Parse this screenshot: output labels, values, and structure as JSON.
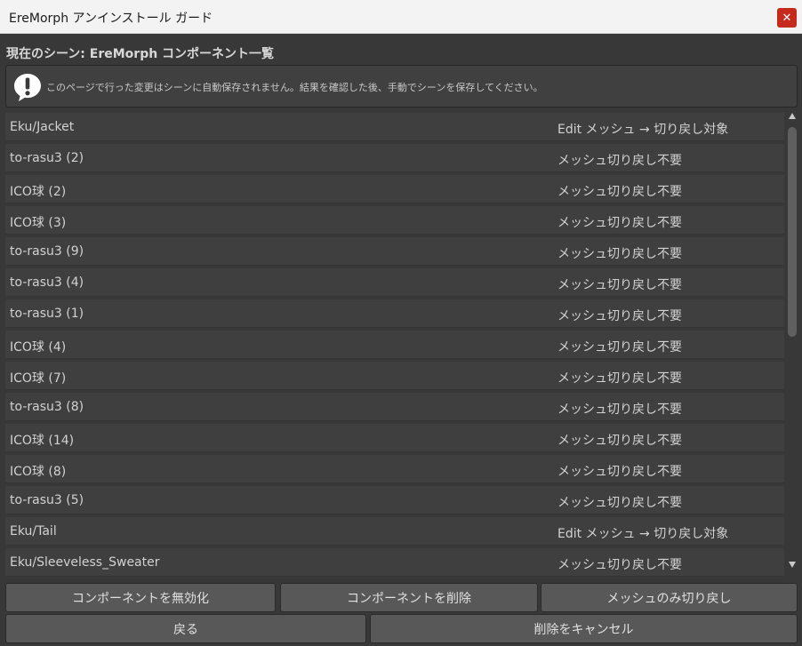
{
  "window": {
    "title": "EreMorph アンインストール ガード",
    "close_glyph": "✕"
  },
  "heading": "現在のシーン: EreMorph コンポーネント一覧",
  "warning": {
    "icon": "warning-exclamation-icon",
    "text": "このページで行った変更はシーンに自動保存されません。結果を確認した後、手動でシーンを保存してください。"
  },
  "rows": [
    {
      "name": "Eku/Jacket",
      "status": "Edit メッシュ → 切り戻し対象"
    },
    {
      "name": "to-rasu3 (2)",
      "status": "メッシュ切り戻し不要"
    },
    {
      "name": "ICO球 (2)",
      "status": "メッシュ切り戻し不要"
    },
    {
      "name": "ICO球 (3)",
      "status": "メッシュ切り戻し不要"
    },
    {
      "name": "to-rasu3 (9)",
      "status": "メッシュ切り戻し不要"
    },
    {
      "name": "to-rasu3 (4)",
      "status": "メッシュ切り戻し不要"
    },
    {
      "name": "to-rasu3 (1)",
      "status": "メッシュ切り戻し不要"
    },
    {
      "name": "ICO球 (4)",
      "status": "メッシュ切り戻し不要"
    },
    {
      "name": "ICO球 (7)",
      "status": "メッシュ切り戻し不要"
    },
    {
      "name": "to-rasu3 (8)",
      "status": "メッシュ切り戻し不要"
    },
    {
      "name": "ICO球 (14)",
      "status": "メッシュ切り戻し不要"
    },
    {
      "name": "ICO球 (8)",
      "status": "メッシュ切り戻し不要"
    },
    {
      "name": "to-rasu3 (5)",
      "status": "メッシュ切り戻し不要"
    },
    {
      "name": "Eku/Tail",
      "status": "Edit メッシュ → 切り戻し対象"
    },
    {
      "name": "Eku/Sleeveless_Sweater",
      "status": "メッシュ切り戻し不要"
    }
  ],
  "buttons": {
    "disable_components": "コンポーネントを無効化",
    "delete_components": "コンポーネントを削除",
    "mesh_revert_only": "メッシュのみ切り戻し",
    "back": "戻る",
    "cancel_delete": "削除をキャンセル"
  },
  "colors": {
    "background": "#383838",
    "row": "#3f3f3f",
    "button": "#585858",
    "close": "#c42b1c",
    "titlebar": "#f3f3f3"
  }
}
